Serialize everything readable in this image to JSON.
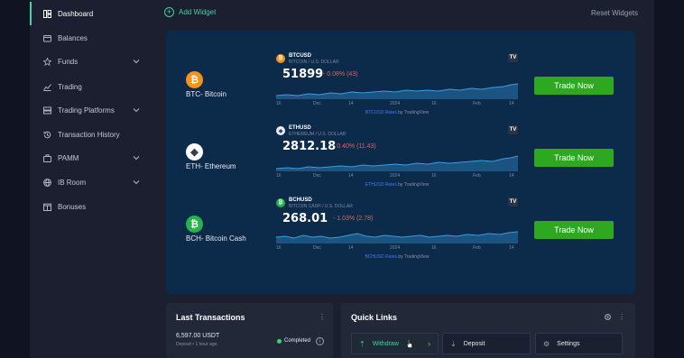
{
  "sidebar": {
    "items": [
      {
        "label": "Dashboard",
        "icon": "grid-icon",
        "active": true
      },
      {
        "label": "Balances",
        "icon": "wallet-icon"
      },
      {
        "label": "Funds",
        "icon": "star-icon",
        "expandable": true
      },
      {
        "label": "Trading",
        "icon": "chart-line-icon"
      },
      {
        "label": "Trading Platforms",
        "icon": "layers-icon",
        "expandable": true
      },
      {
        "label": "Transaction History",
        "icon": "history-icon"
      },
      {
        "label": "PAMM",
        "icon": "briefcase-icon",
        "expandable": true
      },
      {
        "label": "IB Room",
        "icon": "globe-icon",
        "expandable": true
      },
      {
        "label": "Bonuses",
        "icon": "gift-icon"
      }
    ]
  },
  "topbar": {
    "add_widget": "Add Widget",
    "reset_widgets": "Reset Widgets"
  },
  "assets": [
    {
      "name": "BTC- Bitcoin",
      "coin_color": "#f7931a",
      "coin_glyph": "₿",
      "symbol": "BTCUSD",
      "pair": "BITCOIN / U.S. DOLLAR",
      "price": "51899",
      "change": "- 0.08% (43)",
      "ticks": [
        "16",
        "Dec",
        "14",
        "2024",
        "16",
        "Feb",
        "14"
      ],
      "credit_link": "BTCUSD Rates",
      "credit_by": " by TradingView",
      "trade_label": "Trade Now"
    },
    {
      "name": "ETH- Ethereum",
      "coin_color": "#ffffff",
      "coin_glyph": "◆",
      "symbol": "ETHUSD",
      "pair": "ETHEREUM / U.S. DOLLAR",
      "price": "2812.18",
      "change": "- 0.40% (11.43)",
      "ticks": [
        "16",
        "Dec",
        "14",
        "2024",
        "16",
        "Feb",
        "14"
      ],
      "credit_link": "ETHUSD Rates",
      "credit_by": " by TradingView",
      "trade_label": "Trade Now"
    },
    {
      "name": "BCH- Bitcoin Cash",
      "coin_color": "#26b34a",
      "coin_glyph": "₿",
      "symbol": "BCHUSD",
      "pair": "BITCOIN CASH / U.S. DOLLAR",
      "price": "268.01",
      "change": "- 1.03% (2.78)",
      "ticks": [
        "16",
        "Dec",
        "14",
        "2024",
        "16",
        "Feb",
        "14"
      ],
      "credit_link": "BCHUSD Rates",
      "credit_by": " by TradingView",
      "trade_label": "Trade Now"
    }
  ],
  "last_transactions": {
    "title": "Last Transactions",
    "items": [
      {
        "amount": "6,597.00 USDT",
        "meta": "Deposit • 1 hour ago",
        "status": "Completed"
      }
    ]
  },
  "quick_links": {
    "title": "Quick Links",
    "buttons": [
      {
        "label": "Withdraw",
        "icon": "upload-icon"
      },
      {
        "label": "Deposit",
        "icon": "download-icon"
      },
      {
        "label": "Settings",
        "icon": "gear-icon"
      }
    ]
  },
  "colors": {
    "accent": "#3fd4a5",
    "trade_button": "#2ea820",
    "panel": "#0c2a4a",
    "negative": "#f05a63"
  }
}
